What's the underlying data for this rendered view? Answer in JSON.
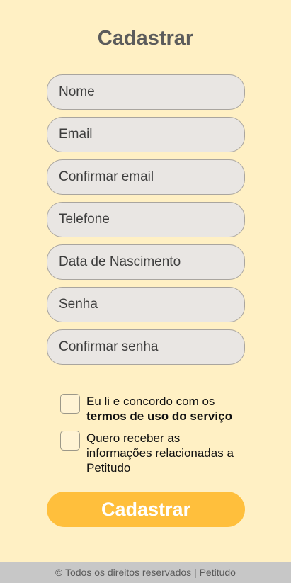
{
  "title": "Cadastrar",
  "form": {
    "fields": [
      {
        "placeholder": "Nome"
      },
      {
        "placeholder": "Email"
      },
      {
        "placeholder": "Confirmar email"
      },
      {
        "placeholder": "Telefone"
      },
      {
        "placeholder": "Data de Nascimento"
      },
      {
        "placeholder": "Senha"
      },
      {
        "placeholder": "Confirmar senha"
      }
    ],
    "terms_text": "Eu li e concordo com os",
    "terms_link": "termos de uso do serviço",
    "newsletter_text": "Quero receber as informações relacionadas a Petitudo",
    "submit_label": "Cadastrar"
  },
  "footer": {
    "text": "© Todos os direitos reservados | Petitudo"
  }
}
